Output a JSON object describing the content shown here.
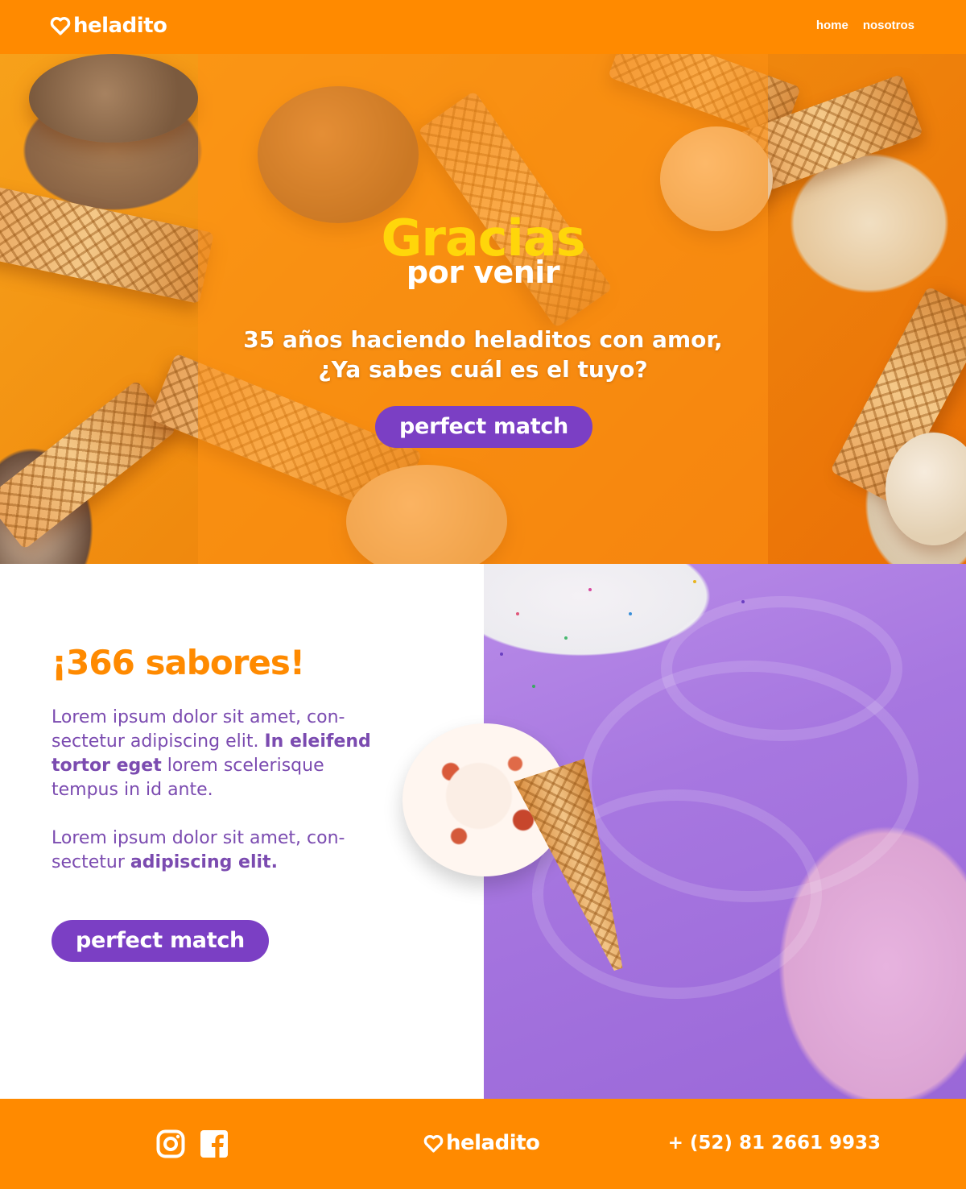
{
  "header": {
    "logo_text": "heladito",
    "nav": [
      {
        "label": "home"
      },
      {
        "label": "nosotros"
      }
    ]
  },
  "hero": {
    "title": "Gracias",
    "subtitle": "por venir",
    "tagline_line1": "35 años haciendo heladitos con amor,",
    "tagline_line2": "¿Ya sabes cuál es el tuyo?",
    "button_label": "perfect match"
  },
  "flavors": {
    "title": "¡366 sabores!",
    "para1_part1": "Lorem ipsum dolor sit amet, con-sectetur adipiscing elit. ",
    "para1_bold": "In eleifend tortor eget",
    "para1_part2": " lorem scelerisque tempus in id ante.",
    "para2_part1": "Lorem ipsum dolor sit amet, con-sectetur ",
    "para2_bold": "adipiscing elit.",
    "button_label": "perfect match"
  },
  "footer": {
    "social_icons": [
      "instagram-icon",
      "facebook-icon"
    ],
    "logo_text": "heladito",
    "phone": "+ (52) 81 2661 9933"
  },
  "colors": {
    "brand_orange": "#FF8A00",
    "accent_purple": "#7B3FC4",
    "title_yellow": "#FFD60A",
    "text_purple": "#7B4BB0"
  }
}
